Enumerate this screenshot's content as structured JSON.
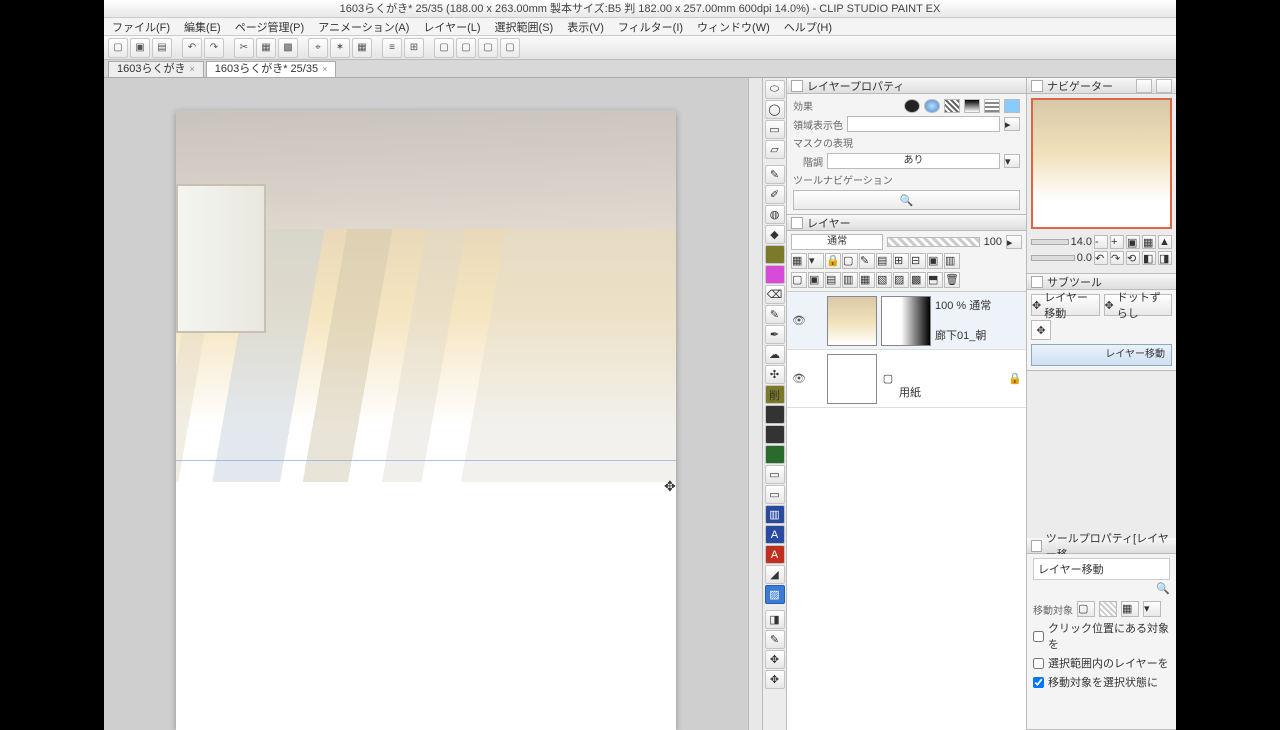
{
  "title": "1603らくがき* 25/35 (188.00 x 263.00mm 製本サイズ:B5 判 182.00 x 257.00mm 600dpi 14.0%)  - CLIP STUDIO PAINT EX",
  "menus": [
    "ファイル(F)",
    "編集(E)",
    "ページ管理(P)",
    "アニメーション(A)",
    "レイヤー(L)",
    "選択範囲(S)",
    "表示(V)",
    "フィルター(I)",
    "ウィンドウ(W)",
    "ヘルプ(H)"
  ],
  "tabs": [
    {
      "label": "1603らくがき",
      "close": "×"
    },
    {
      "label": "1603らくがき* 25/35",
      "close": "×"
    }
  ],
  "layerprop": {
    "tab": "レイヤープロパティ",
    "effect": "効果",
    "region": "領域表示色",
    "mask": "マスクの表現",
    "tone": "階調",
    "tone_val": "あり",
    "toolnav": "ツールナビゲーション"
  },
  "layers": {
    "tab": "レイヤー",
    "mode": "通常",
    "opacity": "100",
    "items": [
      {
        "name": "廊下01_朝",
        "info": "100 %  通常"
      },
      {
        "name": "用紙",
        "info": ""
      }
    ]
  },
  "navigator": {
    "tab": "ナビゲーター",
    "zoom": "14.0",
    "angle": "0.0"
  },
  "subtool": {
    "tab": "サブツール",
    "btn1": "レイヤー移動",
    "btn2": "ドットずらし",
    "big": "レイヤー移動"
  },
  "toolprop": {
    "tab": "ツールプロパティ[レイヤー移",
    "header": "レイヤー移動",
    "target": "移動対象",
    "chk1": "クリック位置にある対象を",
    "chk2": "選択範囲内のレイヤーを",
    "chk3": "移動対象を選択状態に"
  },
  "tools_left": [
    "⬭",
    "◯",
    "▭",
    "▱",
    "✎",
    "✐",
    "◍",
    "◆",
    "■",
    "■",
    "⌫",
    "✎",
    "✒",
    "☁",
    "✣",
    "削",
    "■",
    "■",
    "■",
    "▭",
    "▭",
    "▥",
    "A",
    "A",
    "◢",
    "▨",
    "◨",
    "✎",
    "✥",
    "✥"
  ]
}
